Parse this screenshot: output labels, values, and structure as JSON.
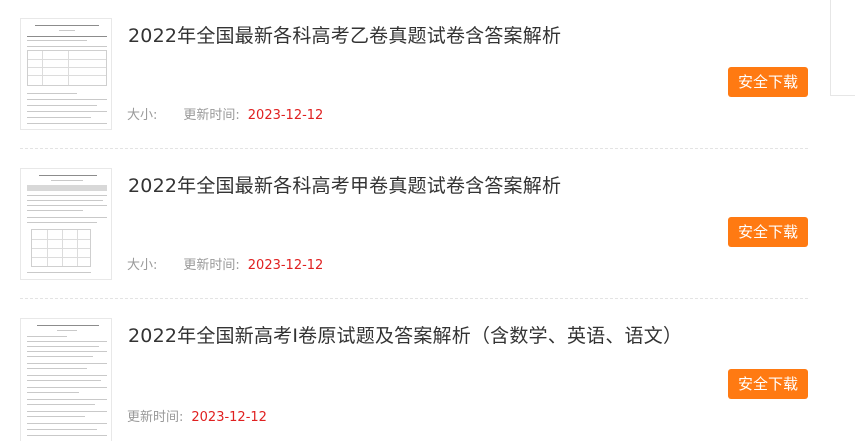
{
  "items": [
    {
      "title": "2022年全国最新各科高考乙卷真题试卷含答案解析",
      "size_label": "大小:",
      "update_label": "更新时间:",
      "update_date": "2023-12-12",
      "download_label": "安全下载"
    },
    {
      "title": "2022年全国最新各科高考甲卷真题试卷含答案解析",
      "size_label": "大小:",
      "update_label": "更新时间:",
      "update_date": "2023-12-12",
      "download_label": "安全下载"
    },
    {
      "title": "2022年全国新高考I卷原试题及答案解析（含数学、英语、语文）",
      "update_label": "更新时间:",
      "update_date": "2023-12-12",
      "download_label": "安全下载"
    }
  ],
  "colors": {
    "button_bg": "#ff7a12",
    "date_text": "#e02020",
    "title_text": "#333333",
    "label_text": "#999999"
  }
}
